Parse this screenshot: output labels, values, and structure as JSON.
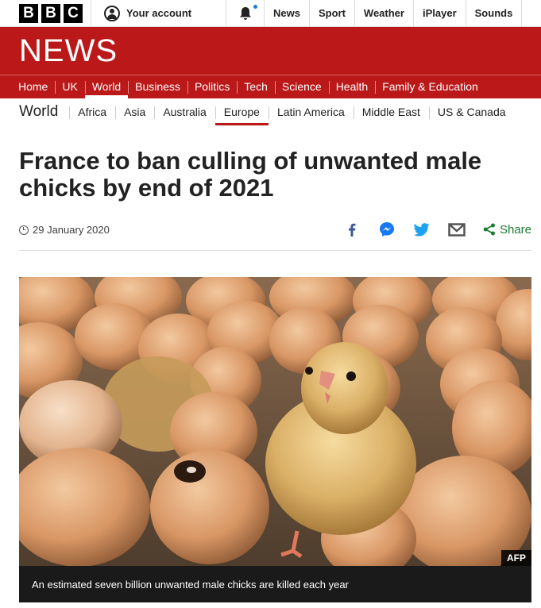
{
  "brand": {
    "bbc_letters": [
      "B",
      "B",
      "C"
    ],
    "news_logo": "NEWS",
    "accent": "#bb1919"
  },
  "topbar": {
    "account_label": "Your account",
    "links": [
      "News",
      "Sport",
      "Weather",
      "iPlayer",
      "Sounds"
    ]
  },
  "mainnav": {
    "items": [
      "Home",
      "UK",
      "World",
      "Business",
      "Politics",
      "Tech",
      "Science",
      "Health",
      "Family & Education"
    ],
    "active": "World"
  },
  "subnav": {
    "title": "World",
    "items": [
      "Africa",
      "Asia",
      "Australia",
      "Europe",
      "Latin America",
      "Middle East",
      "US & Canada"
    ],
    "active": "Europe"
  },
  "article": {
    "headline": "France to ban culling of unwanted male chicks by end of 2021",
    "date": "29 January 2020",
    "share_label": "Share",
    "share_icons": [
      "facebook-icon",
      "messenger-icon",
      "twitter-icon",
      "email-icon",
      "share-icon"
    ],
    "image_credit": "AFP",
    "caption": "An estimated seven billion unwanted male chicks are killed each year"
  }
}
